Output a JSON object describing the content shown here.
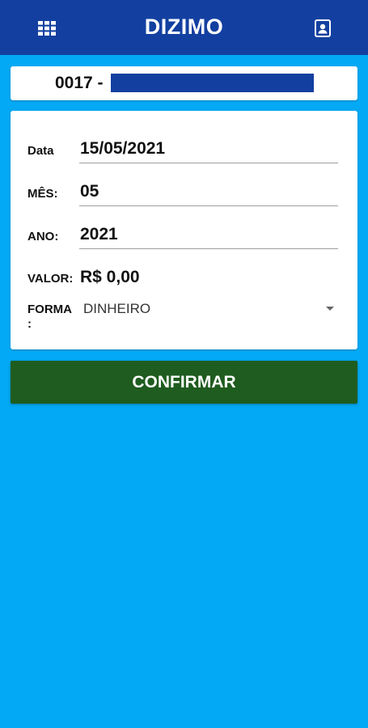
{
  "app": {
    "title": "DIZIMO",
    "menu_icon": "grid-icon",
    "profile_icon": "contact-card-icon",
    "colors": {
      "app_bar": "#1340a0",
      "background": "#03a9f4",
      "confirm_button": "#1f5c1f"
    }
  },
  "member": {
    "code": "0017 -"
  },
  "form": {
    "date_label": "Data",
    "date_value": "15/05/2021",
    "month_label": "MÊS:",
    "month_value": "05",
    "year_label": "ANO:",
    "year_value": "2021",
    "amount_label": "VALOR:",
    "amount_value": "R$ 0,00",
    "payment_label": "FORMA :",
    "payment_selected": "DINHEIRO"
  },
  "actions": {
    "confirm_label": "CONFIRMAR"
  }
}
